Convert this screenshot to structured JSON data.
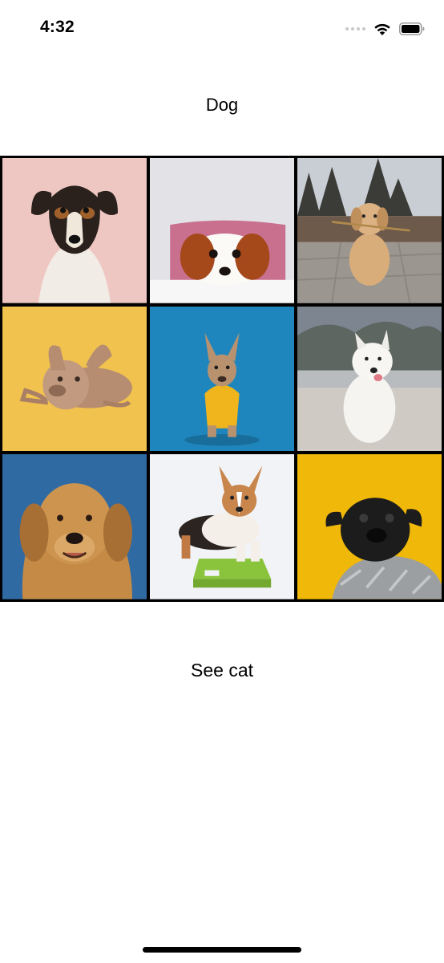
{
  "status_bar": {
    "time": "4:32",
    "icons": [
      "cellular-signal-icon",
      "wifi-icon",
      "battery-icon"
    ]
  },
  "header": {
    "title": "Dog"
  },
  "gallery": {
    "tiles": [
      {
        "subject": "dog-photo",
        "background": "#efc7c2"
      },
      {
        "subject": "dog-photo",
        "background": "#e3e3e7"
      },
      {
        "subject": "dog-photo",
        "background": "#8a8a86"
      },
      {
        "subject": "dog-photo",
        "background": "#f1c24d"
      },
      {
        "subject": "dog-photo",
        "background": "#1f86bd"
      },
      {
        "subject": "dog-photo",
        "background": "#b9bcbf"
      },
      {
        "subject": "dog-photo",
        "background": "#2f6aa3"
      },
      {
        "subject": "dog-photo",
        "background": "#f1f3f7"
      },
      {
        "subject": "dog-photo",
        "background": "#f0b809"
      }
    ]
  },
  "actions": {
    "see_cat_label": "See cat"
  }
}
